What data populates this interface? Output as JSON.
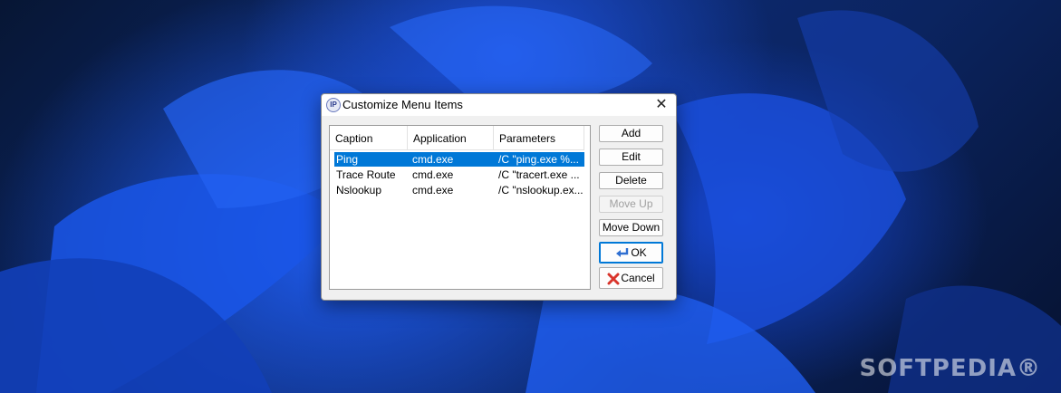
{
  "window": {
    "title": "Customize Menu Items",
    "icon_text": "IP",
    "close_glyph": "✕"
  },
  "listview": {
    "columns": [
      "Caption",
      "Application",
      "Parameters"
    ],
    "rows": [
      {
        "caption": "Ping",
        "application": "cmd.exe",
        "parameters": "/C \"ping.exe %...",
        "selected": true
      },
      {
        "caption": "Trace Route",
        "application": "cmd.exe",
        "parameters": "/C \"tracert.exe ...",
        "selected": false
      },
      {
        "caption": "Nslookup",
        "application": "cmd.exe",
        "parameters": "/C \"nslookup.ex...",
        "selected": false
      }
    ]
  },
  "buttons": {
    "add": "Add",
    "edit": "Edit",
    "delete": "Delete",
    "move_up": "Move Up",
    "move_down": "Move Down",
    "ok": "OK",
    "cancel": "Cancel"
  },
  "watermark": "SOFTPEDIA®",
  "colors": {
    "selection": "#0078d7",
    "ok_icon": "#2f6fd1",
    "cancel_icon": "#d9342b"
  }
}
